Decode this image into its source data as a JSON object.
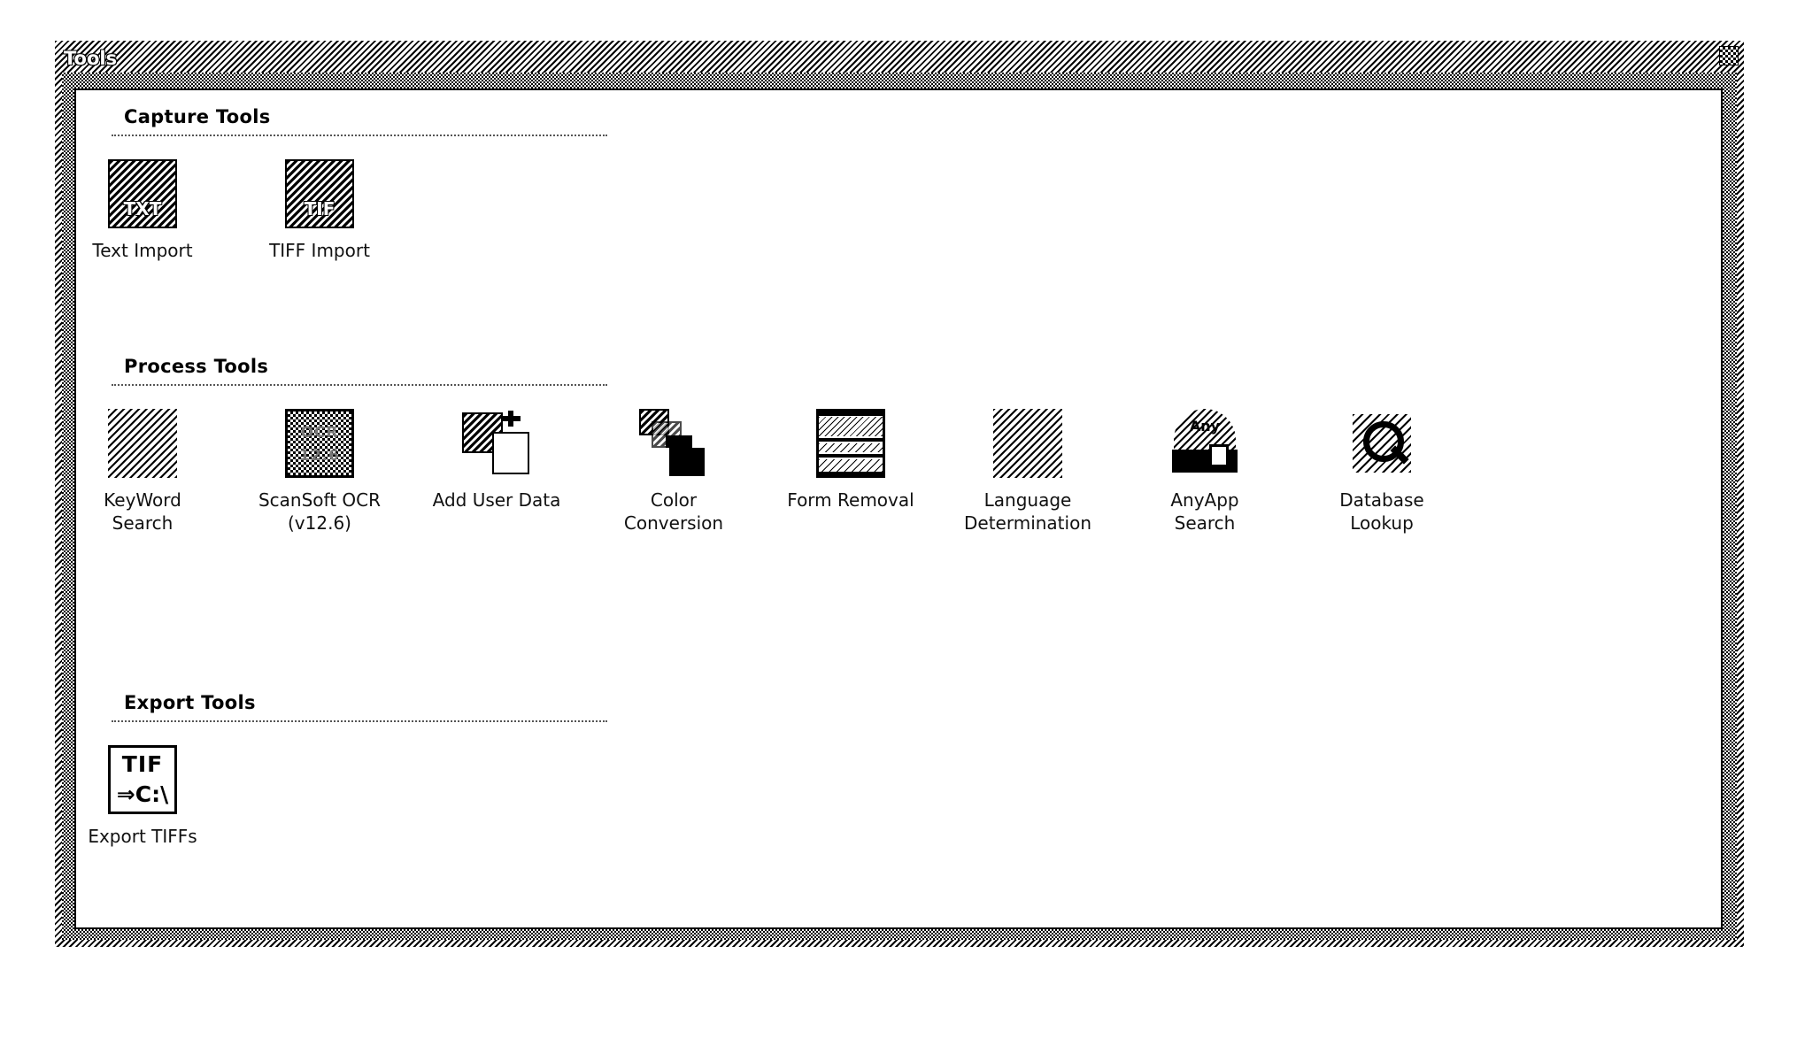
{
  "window": {
    "title": "Tools",
    "close_icon": "close-icon"
  },
  "groups": [
    {
      "id": "capture",
      "header": "Capture Tools",
      "tools": [
        {
          "label": "Text Import",
          "icon": "text-import-icon",
          "glyph": "TXT",
          "style": "hatch-dark"
        },
        {
          "label": "TIFF Import",
          "icon": "tiff-import-icon",
          "glyph": "TIF",
          "style": "hatch-dark"
        }
      ]
    },
    {
      "id": "process",
      "header": "Process Tools",
      "tools": [
        {
          "label": "KeyWord\nSearch",
          "icon": "keyword-search-icon",
          "glyph": "",
          "style": "hatch-soft"
        },
        {
          "label": "ScanSoft OCR\n(v12.6)",
          "icon": "scansoft-ocr-icon",
          "glyph": "OCR\n12.6",
          "style": "dot-box"
        },
        {
          "label": "Add User Data",
          "icon": "add-user-data-icon",
          "glyph": "",
          "style": "user-data"
        },
        {
          "label": "Color\nConversion",
          "icon": "color-conversion-icon",
          "glyph": "",
          "style": "color-conv"
        },
        {
          "label": "Form Removal",
          "icon": "form-removal-icon",
          "glyph": "",
          "style": "form"
        },
        {
          "label": "Language\nDetermination",
          "icon": "language-determination-icon",
          "glyph": "",
          "style": "hatch-soft"
        },
        {
          "label": "AnyApp\nSearch",
          "icon": "anyapp-search-icon",
          "glyph": "Any",
          "style": "anyapp"
        },
        {
          "label": "Database\nLookup",
          "icon": "database-lookup-icon",
          "glyph": "",
          "style": "database"
        }
      ]
    },
    {
      "id": "export",
      "header": "Export Tools",
      "tools": [
        {
          "label": "Export TIFFs",
          "icon": "export-tiffs-icon",
          "glyph_top": "TIF",
          "glyph_bottom": "⇒C:\\",
          "style": "white-box"
        }
      ]
    }
  ],
  "colors": {
    "background": "#ffffff",
    "foreground": "#000000",
    "frame": "#808080"
  }
}
